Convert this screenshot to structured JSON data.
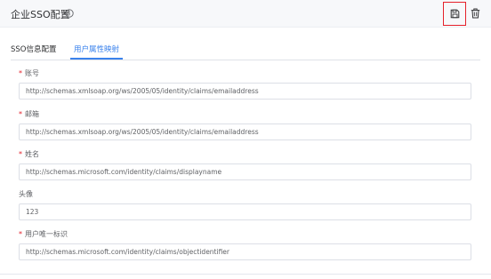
{
  "header": {
    "title": "企业SSO配置",
    "info_icon": "info-circle-icon",
    "save_icon": "save-icon",
    "delete_icon": "trash-icon"
  },
  "tabs": [
    {
      "label": "SSO信息配置",
      "active": false
    },
    {
      "label": "用户属性映射",
      "active": true
    }
  ],
  "fields": [
    {
      "label": "账号",
      "required": true,
      "value": "http://schemas.xmlsoap.org/ws/2005/05/identity/claims/emailaddress"
    },
    {
      "label": "邮箱",
      "required": true,
      "value": "http://schemas.xmlsoap.org/ws/2005/05/identity/claims/emailaddress"
    },
    {
      "label": "姓名",
      "required": true,
      "value": "http://schemas.microsoft.com/identity/claims/displayname"
    },
    {
      "label": "头像",
      "required": false,
      "value": "123"
    },
    {
      "label": "用户唯一标识",
      "required": true,
      "value": "http://schemas.microsoft.com/identity/claims/objectidentifier"
    }
  ],
  "colors": {
    "accent": "#3a82ec",
    "required": "#e5202a",
    "highlight_border": "#e5202a"
  }
}
